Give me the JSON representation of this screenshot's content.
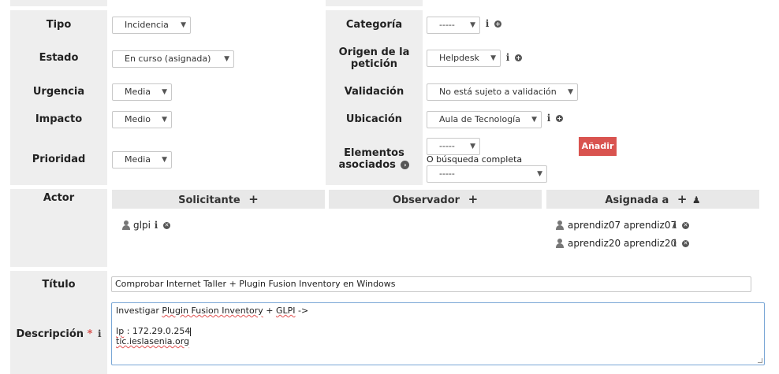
{
  "left_fields": {
    "tipo": {
      "label": "Tipo",
      "value": "Incidencia"
    },
    "estado": {
      "label": "Estado",
      "value": "En curso (asignada)"
    },
    "urgencia": {
      "label": "Urgencia",
      "value": "Media"
    },
    "impacto": {
      "label": "Impacto",
      "value": "Medio"
    },
    "prioridad": {
      "label": "Prioridad",
      "value": "Media"
    }
  },
  "right_fields": {
    "categoria": {
      "label": "Categoría",
      "value": "-----"
    },
    "origen": {
      "label_line1": "Origen de la",
      "label_line2": "petición",
      "value": "Helpdesk"
    },
    "validacion": {
      "label": "Validación",
      "value": "No está sujeto a validación"
    },
    "ubicacion": {
      "label": "Ubicación",
      "value": "Aula de Tecnología"
    },
    "elementos": {
      "label_line1": "Elementos",
      "label_line2": "asociados",
      "select_value": "-----",
      "add_button": "Añadir",
      "full_search_text": "O búsqueda completa",
      "search_select_value": "-----"
    }
  },
  "actors": {
    "label": "Actor",
    "solicitante": {
      "header": "Solicitante",
      "users": [
        "glpi"
      ]
    },
    "observador": {
      "header": "Observador",
      "users": []
    },
    "asignada": {
      "header": "Asignada a",
      "users": [
        "aprendiz07 aprendiz07",
        "aprendiz20 aprendiz20"
      ]
    }
  },
  "titulo": {
    "label": "Título",
    "value": "Comprobar Internet Taller + Plugin Fusion Inventory en Windows"
  },
  "descripcion": {
    "label": "Descripción",
    "required_mark": "*",
    "line1_a": "Investigar ",
    "line1_b": "Plugin Fusion Inventory",
    "line1_c": " + ",
    "line1_d": "GLPI",
    "line1_e": " ->",
    "line3_a": "Ip",
    "line3_b": " : 172.29.0.254",
    "line4": "tic.ieslasenia.org"
  },
  "colors": {
    "accent_red": "#d9534f",
    "panel_grey": "#eeeeee",
    "focus_border": "#7aa7d6"
  }
}
